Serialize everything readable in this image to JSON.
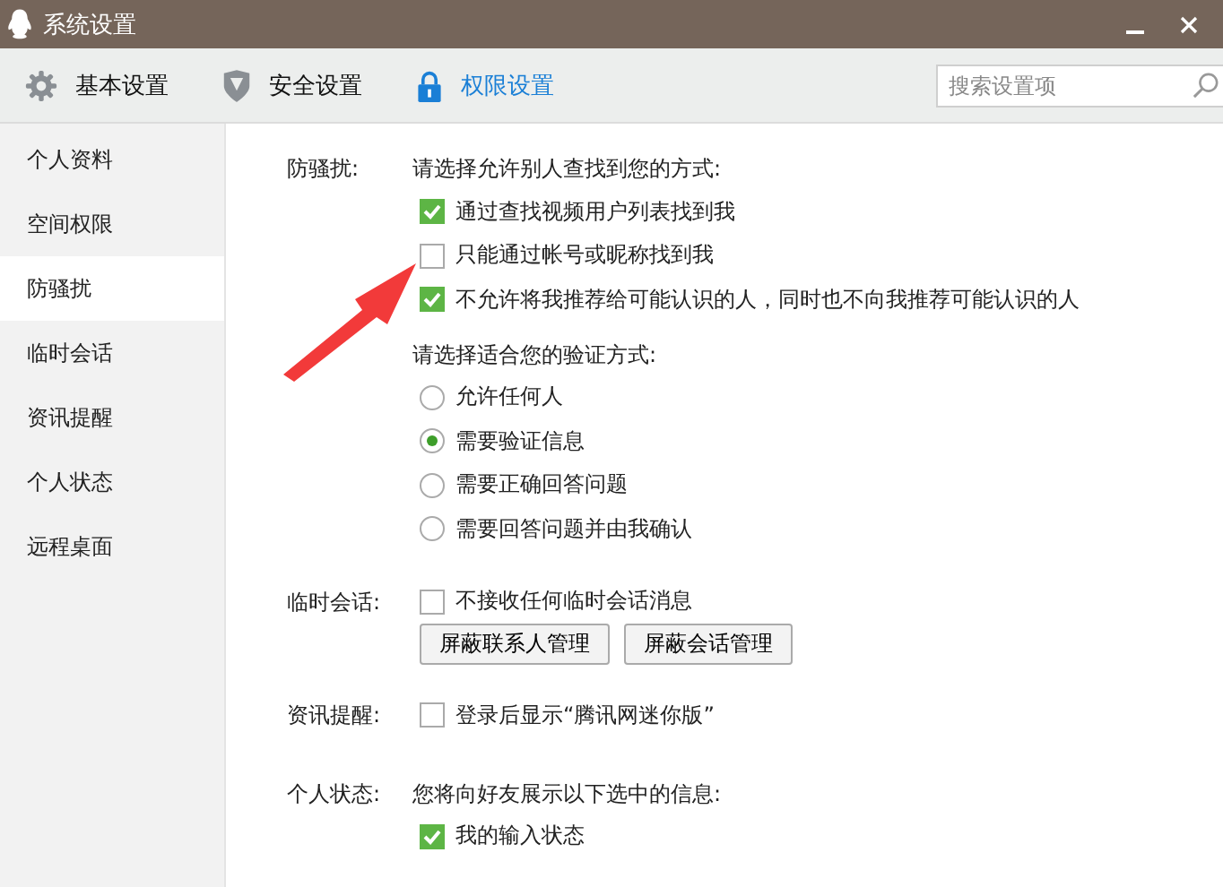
{
  "window": {
    "title": "系统设置"
  },
  "tabs": [
    {
      "label": "基本设置",
      "kind": "gear",
      "selected": false
    },
    {
      "label": "安全设置",
      "kind": "shield",
      "selected": false
    },
    {
      "label": "权限设置",
      "kind": "lock",
      "selected": true
    }
  ],
  "search": {
    "placeholder": "搜索设置项"
  },
  "sidebar": {
    "items": [
      {
        "label": "个人资料",
        "selected": false
      },
      {
        "label": "空间权限",
        "selected": false
      },
      {
        "label": "防骚扰",
        "selected": true
      },
      {
        "label": "临时会话",
        "selected": false
      },
      {
        "label": "资讯提醒",
        "selected": false
      },
      {
        "label": "个人状态",
        "selected": false
      },
      {
        "label": "远程桌面",
        "selected": false
      }
    ]
  },
  "sections": [
    {
      "label": "防骚扰:",
      "items": [
        {
          "kind": "prompt",
          "text": "请选择允许别人查找到您的方式:"
        },
        {
          "kind": "checkbox",
          "text": "通过查找视频用户列表找到我",
          "checked": true
        },
        {
          "kind": "checkbox",
          "text": "只能通过帐号或昵称找到我",
          "checked": false
        },
        {
          "kind": "checkbox",
          "text": "不允许将我推荐给可能认识的人，同时也不向我推荐可能认识的人",
          "checked": true
        },
        {
          "kind": "prompt",
          "text": "请选择适合您的验证方式:"
        },
        {
          "kind": "radio",
          "text": "允许任何人",
          "selected": false
        },
        {
          "kind": "radio",
          "text": "需要验证信息",
          "selected": true
        },
        {
          "kind": "radio",
          "text": "需要正确回答问题",
          "selected": false
        },
        {
          "kind": "radio",
          "text": "需要回答问题并由我确认",
          "selected": false
        }
      ]
    },
    {
      "label": "临时会话:",
      "items": [
        {
          "kind": "checkbox",
          "text": "不接收任何临时会话消息",
          "checked": false
        },
        {
          "kind": "buttons",
          "buttons": [
            "屏蔽联系人管理",
            "屏蔽会话管理"
          ]
        }
      ]
    },
    {
      "label": "资讯提醒:",
      "items": [
        {
          "kind": "checkbox",
          "text": "登录后显示“腾讯网迷你版”",
          "checked": false
        }
      ]
    },
    {
      "label": "个人状态:",
      "items": [
        {
          "kind": "prompt",
          "text": "您将向好友展示以下选中的信息:"
        },
        {
          "kind": "checkbox",
          "text": "我的输入状态",
          "checked": true
        }
      ]
    }
  ]
}
